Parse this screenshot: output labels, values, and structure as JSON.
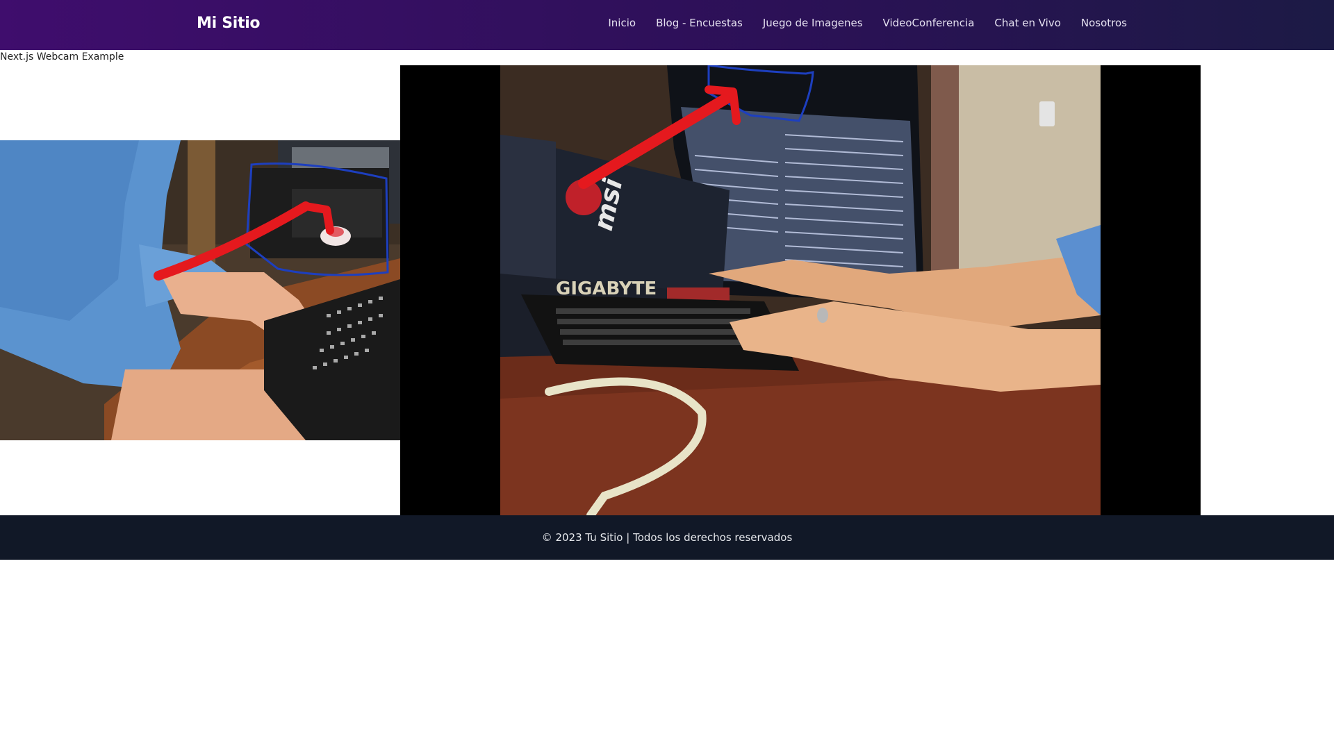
{
  "navbar": {
    "brand": "Mi Sitio",
    "links": [
      {
        "label": "Inicio"
      },
      {
        "label": "Blog - Encuestas"
      },
      {
        "label": "Juego de Imagenes"
      },
      {
        "label": "VideoConferencia"
      },
      {
        "label": "Chat en Vivo"
      },
      {
        "label": "Nosotros"
      }
    ]
  },
  "main": {
    "page_label": "Next.js Webcam Example",
    "webcam_view": {
      "icon": "webcam-capture"
    },
    "video_view": {
      "icon": "remote-video-stream",
      "visible_brand_labels": [
        "GIGABYTE",
        "msi"
      ]
    }
  },
  "footer": {
    "text": "© 2023 Tu Sitio | Todos los derechos reservados"
  },
  "colors": {
    "navbar_start": "#3f0d6d",
    "navbar_end": "#1c1a45",
    "footer_bg": "#111827",
    "video_bg": "#000000",
    "annotation_red": "#e5191e",
    "annotation_blue": "#1d3fbf"
  }
}
